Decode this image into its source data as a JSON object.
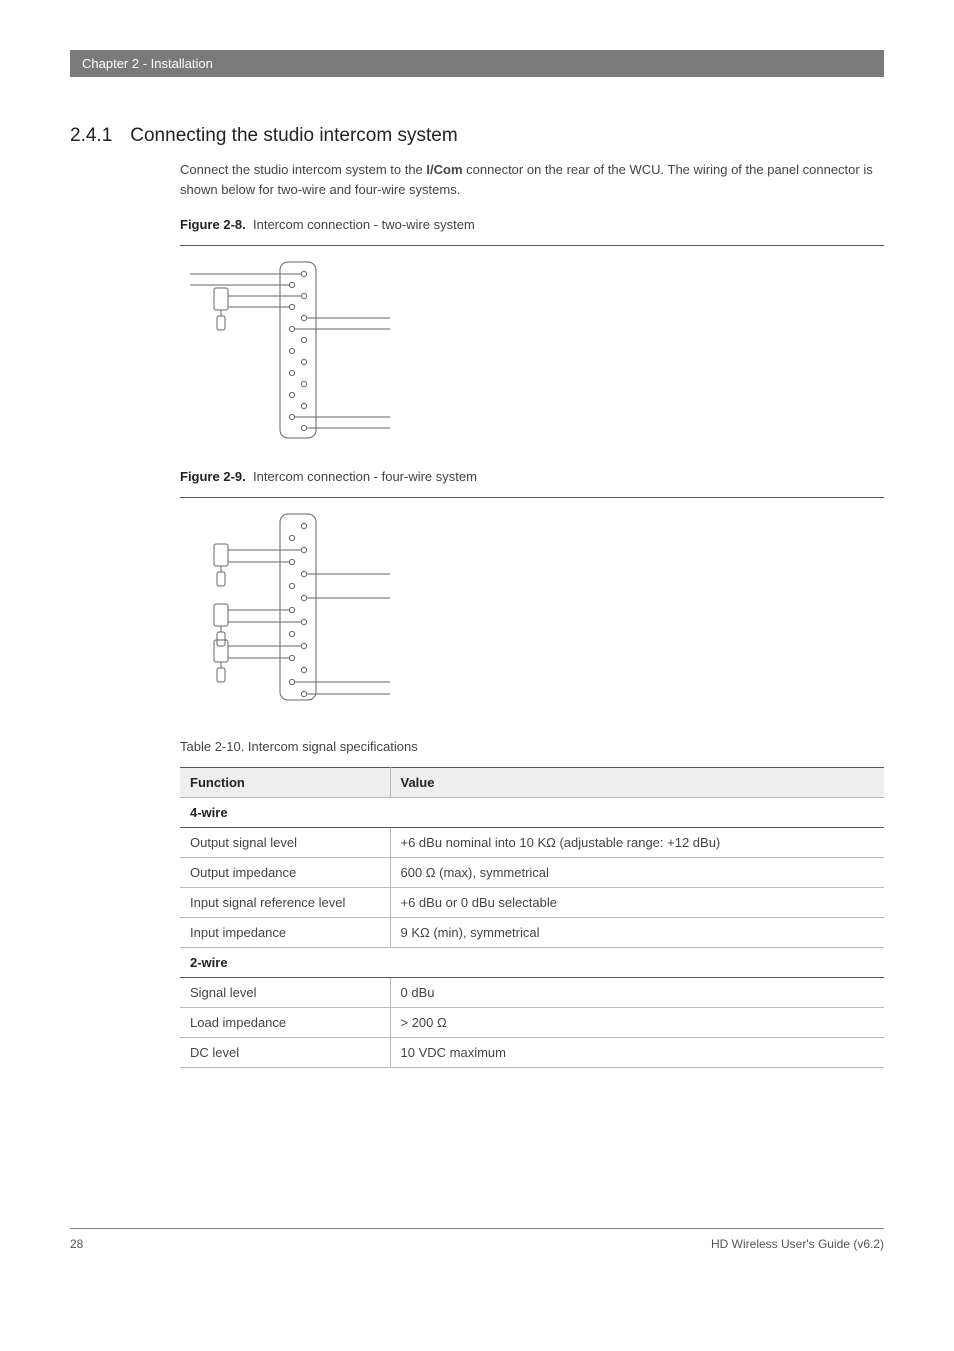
{
  "chapter_bar": "Chapter 2  - Installation",
  "section": {
    "number": "2.4.1",
    "title": "Connecting the studio intercom system"
  },
  "intro_html": "Connect the studio intercom system to the <b>I/Com</b> connector on the rear of the WCU. The wiring of the panel connector is shown below for two-wire and four-wire systems.",
  "fig28": {
    "label": "Figure 2-8.",
    "text": "Intercom connection - two-wire system"
  },
  "fig29": {
    "label": "Figure 2-9.",
    "text": "Intercom connection - four-wire system"
  },
  "table_caption": "Table 2-10.  Intercom signal specifications",
  "table_head": {
    "c1": "Function",
    "c2": "Value"
  },
  "cat_4wire": "4-wire",
  "rows_4wire": [
    {
      "f": "Output signal level",
      "v": "+6 dBu nominal into 10 KΩ (adjustable range: +12 dBu)"
    },
    {
      "f": "Output impedance",
      "v": "600 Ω (max), symmetrical"
    },
    {
      "f": "Input signal reference level",
      "v": "+6 dBu or 0 dBu selectable"
    },
    {
      "f": "Input impedance",
      "v": "9 KΩ (min), symmetrical"
    }
  ],
  "cat_2wire": "2-wire",
  "rows_2wire": [
    {
      "f": "Signal level",
      "v": "0 dBu"
    },
    {
      "f": "Load impedance",
      "v": "> 200 Ω"
    },
    {
      "f": "DC level",
      "v": "10 VDC maximum"
    }
  ],
  "footer": {
    "page": "28",
    "doc": "HD Wireless User's Guide (v6.2)"
  }
}
